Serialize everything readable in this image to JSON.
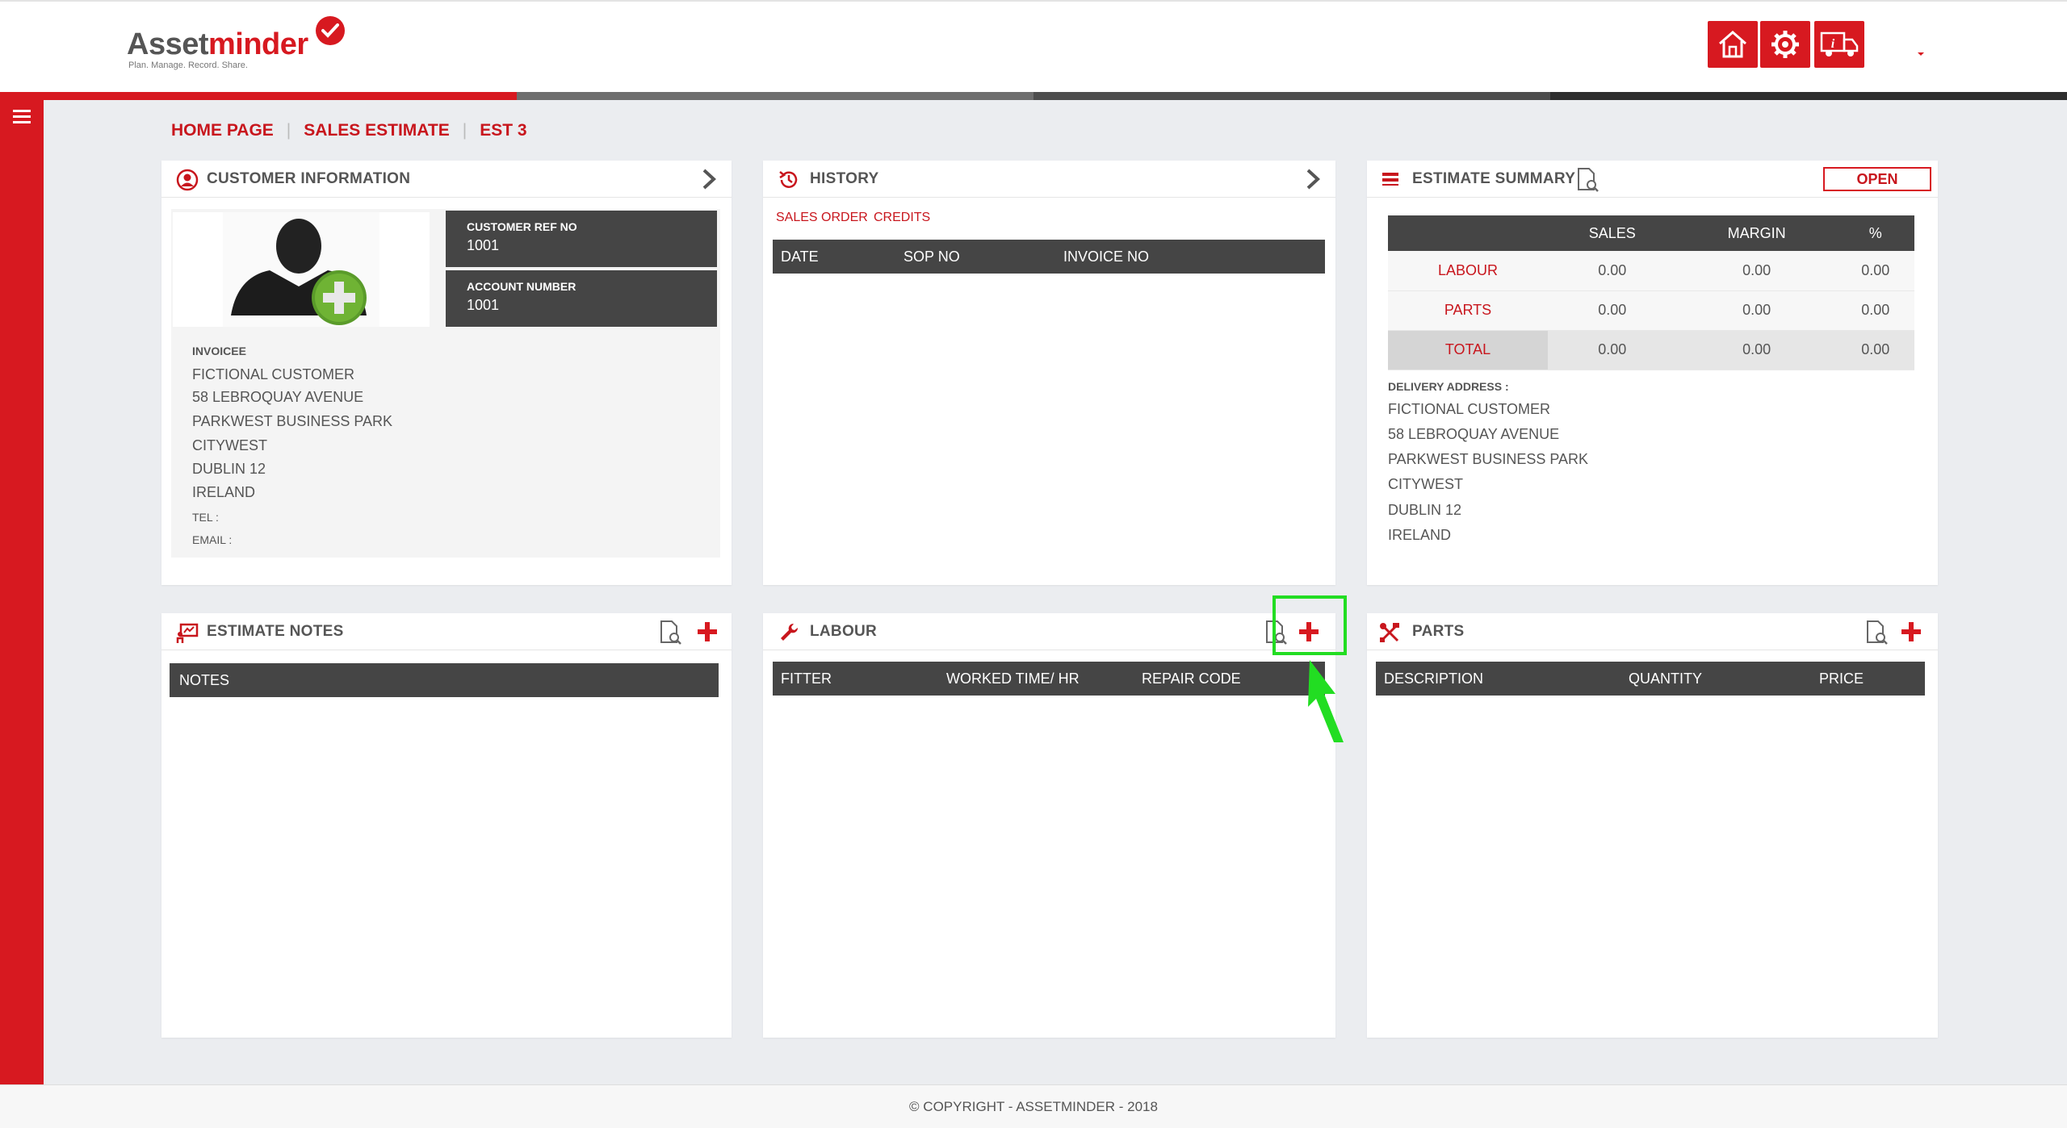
{
  "header": {
    "logo": {
      "part1": "Asset",
      "part2": "minder",
      "tagline": "Plan. Manage. Record. Share."
    },
    "buttons": [
      {
        "name": "home-button",
        "icon": "home-icon"
      },
      {
        "name": "settings-button",
        "icon": "gear-icon"
      },
      {
        "name": "delivery-button",
        "icon": "truck-icon"
      }
    ],
    "progress_colors": [
      "#d71920",
      "#6e6e6e",
      "#4d4d4d",
      "#2e2e2e"
    ]
  },
  "breadcrumb": {
    "home": "HOME PAGE",
    "section": "SALES ESTIMATE",
    "current": "EST 3"
  },
  "customer": {
    "title": "CUSTOMER INFORMATION",
    "ref_label": "CUSTOMER REF NO",
    "ref_value": "1001",
    "account_label": "ACCOUNT NUMBER",
    "account_value": "1001",
    "invoicee_label": "INVOICEE",
    "address": [
      "FICTIONAL CUSTOMER",
      "58 LEBROQUAY AVENUE",
      "PARKWEST BUSINESS PARK",
      "CITYWEST",
      "DUBLIN 12",
      "IRELAND"
    ],
    "tel_label": "TEL :",
    "email_label": "EMAIL :"
  },
  "history": {
    "title": "HISTORY",
    "tabs": [
      "SALES ORDER",
      "CREDITS"
    ],
    "columns": [
      "DATE",
      "SOP NO",
      "INVOICE NO"
    ]
  },
  "summary": {
    "title": "ESTIMATE SUMMARY",
    "status": "OPEN",
    "columns": [
      "",
      "SALES",
      "MARGIN",
      "%"
    ],
    "rows": [
      {
        "label": "LABOUR",
        "sales": "0.00",
        "margin": "0.00",
        "pct": "0.00"
      },
      {
        "label": "PARTS",
        "sales": "0.00",
        "margin": "0.00",
        "pct": "0.00"
      },
      {
        "label": "TOTAL",
        "sales": "0.00",
        "margin": "0.00",
        "pct": "0.00"
      }
    ],
    "delivery_label": "DELIVERY ADDRESS :",
    "delivery": [
      "FICTIONAL CUSTOMER",
      "58 LEBROQUAY AVENUE",
      "PARKWEST BUSINESS PARK",
      "CITYWEST",
      "DUBLIN 12",
      "IRELAND"
    ]
  },
  "notes": {
    "title": "ESTIMATE NOTES",
    "columns": [
      "NOTES"
    ]
  },
  "labour": {
    "title": "LABOUR",
    "columns": [
      "FITTER",
      "WORKED TIME/ HR",
      "REPAIR CODE"
    ]
  },
  "parts": {
    "title": "PARTS",
    "columns": [
      "DESCRIPTION",
      "QUANTITY",
      "PRICE"
    ]
  },
  "footer": {
    "text": "© COPYRIGHT - ASSETMINDER - 2018"
  }
}
